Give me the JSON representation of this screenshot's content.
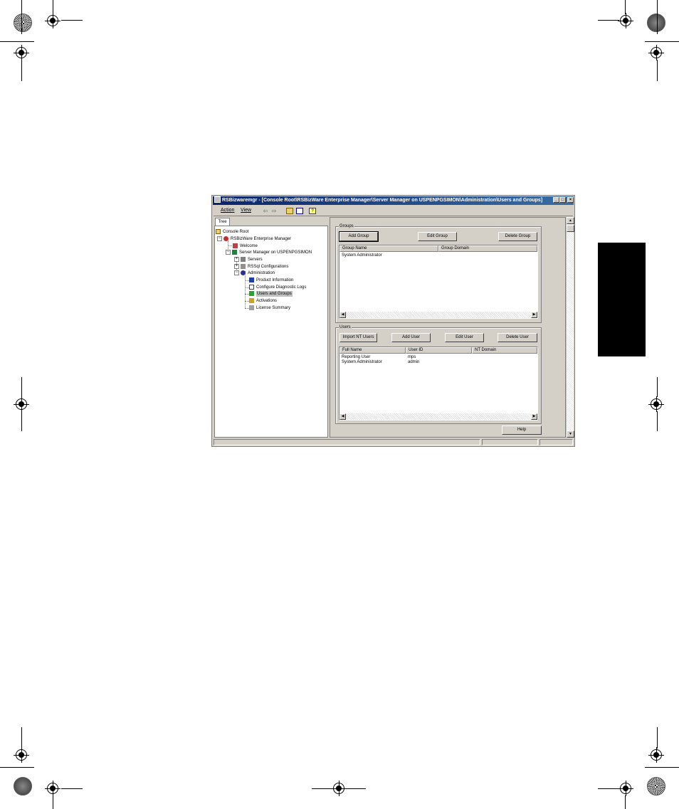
{
  "window": {
    "title": "RSBizwaremgr - [Console Root\\RSBizWare Enterprise Manager\\Server Manager on USPENPGSIMON\\Administration\\Users and Groups]",
    "minimize": "_",
    "maximize": "□",
    "close": "×"
  },
  "menubar": {
    "action": "Action",
    "view": "View"
  },
  "tree": {
    "tab_label": "Tree",
    "items": [
      {
        "label": "Console Root",
        "icon": "folder-icon"
      },
      {
        "label": "RSBizWare Enterprise Manager",
        "icon": "enterprise-manager-icon"
      },
      {
        "label": "Welcome",
        "icon": "welcome-icon"
      },
      {
        "label": "Server Manager on USPENPGSIMON",
        "icon": "server-manager-icon"
      },
      {
        "label": "Servers",
        "icon": "servers-icon"
      },
      {
        "label": "RSSql Configurations",
        "icon": "rssql-icon"
      },
      {
        "label": "Administration",
        "icon": "administration-icon"
      },
      {
        "label": "Product Information",
        "icon": "product-info-icon"
      },
      {
        "label": "Configure Diagnostic Logs",
        "icon": "diagnostic-logs-icon"
      },
      {
        "label": "Users and Groups",
        "icon": "users-groups-icon"
      },
      {
        "label": "Activations",
        "icon": "activations-icon"
      },
      {
        "label": "License Summary",
        "icon": "license-icon"
      }
    ]
  },
  "groups": {
    "label": "Groups",
    "buttons": {
      "add": "Add Group",
      "edit": "Edit Group",
      "delete": "Delete Group"
    },
    "columns": [
      "Group Name",
      "Group Domain"
    ],
    "rows": [
      [
        "System Administrator",
        ""
      ]
    ]
  },
  "users": {
    "label": "Users",
    "buttons": {
      "import": "Import NT Users",
      "add": "Add User",
      "edit": "Edit User",
      "delete": "Delete User"
    },
    "columns": [
      "Full Name",
      "User ID",
      "NT Domain"
    ],
    "rows": [
      [
        "Reporting User",
        "mps",
        ""
      ],
      [
        "System Administrator",
        "admin",
        ""
      ]
    ]
  },
  "help_button": "Help"
}
